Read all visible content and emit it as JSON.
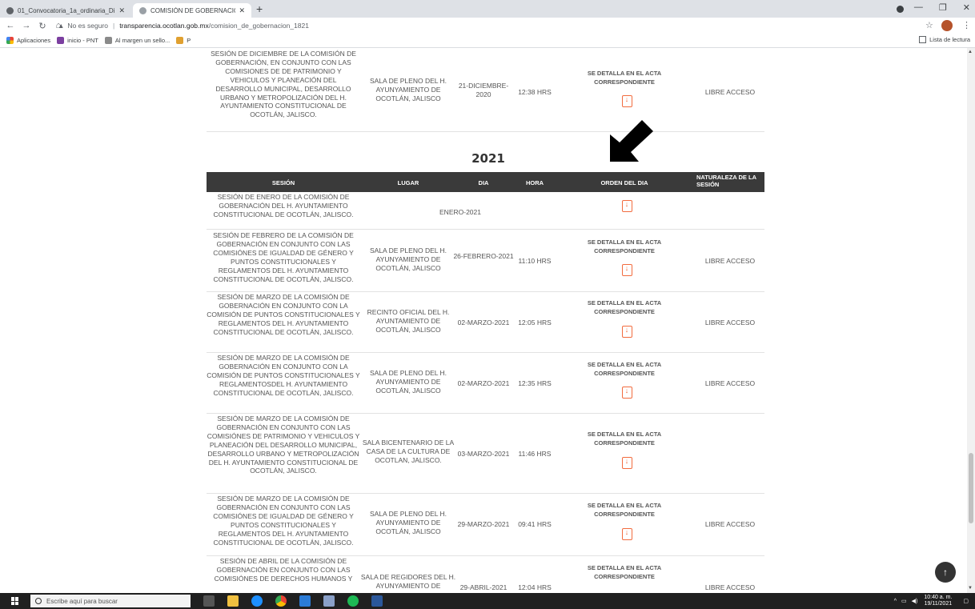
{
  "browser": {
    "tabs": [
      {
        "title": "01_Convocatoria_1a_ordinaria_Di",
        "active": false
      },
      {
        "title": "COMISIÓN DE GOBERNACIÓN |",
        "active": true
      }
    ],
    "url_warning": "No es seguro",
    "url_host": "transparencia.ocotlan.gob.mx",
    "url_path": "/comision_de_gobernacion_1821",
    "bookmarks": [
      "Aplicaciones",
      "inicio - PNT",
      "Al margen un sello...",
      "P"
    ],
    "reading_list": "Lista de lectura"
  },
  "prev_row": {
    "sesion": "SESIÓN DE DICIEMBRE DE LA COMISIÓN DE GOBERNACIÓN, EN CONJUNTO CON LAS COMISIONES DE DE PATRIMONIO Y VEHICULOS Y PLANEACIÓN DEL DESARROLLO MUNICIPAL, DESARROLLO URBANO Y METROPOLIZACIÓN DEL H. AYUNTAMIENTO CONSTITUCIONAL DE OCOTLÁN, JALISCO.",
    "lugar": "SALA DE PLENO DEL H. AYUNYAMIENTO DE OCOTLÁN, JALISCO",
    "dia": "21-DICIEMBRE-2020",
    "hora": "12:38 HRS",
    "orden": "SE DETALLA EN EL ACTA CORRESPONDIENTE",
    "naturaleza": "LIBRE ACCESO"
  },
  "year": "2021",
  "headers": {
    "sesion": "SESIÓN",
    "lugar": "LUGAR",
    "dia": "DIA",
    "hora": "HORA",
    "orden": "ORDEN DEL DIA",
    "naturaleza": "NATURALEZA DE LA SESIÓN"
  },
  "rows": [
    {
      "sesion": "SESIÓN DE ENERO DE LA COMISIÓN DE GOBERNACIÓN DEL H. AYUNTAMIENTO CONSTITUCIONAL DE OCOTLÁN, JALISCO.",
      "lugar": "",
      "dia": "ENERO-2021",
      "hora": "",
      "orden": "",
      "naturaleza": ""
    },
    {
      "sesion": "SESIÓN DE FEBRERO DE LA COMISIÓN DE GOBERNACIÓN EN CONJUNTO CON LAS COMISIÓNES DE IGUALDAD DE GÉNERO Y PUNTOS CONSTITUCIONALES Y REGLAMENTOS DEL H. AYUNTAMIENTO CONSTITUCIONAL DE OCOTLÁN, JALISCO.",
      "lugar": "SALA DE PLENO DEL H. AYUNYAMIENTO DE OCOTLÁN, JALISCO",
      "dia": "26-FEBRERO-2021",
      "hora": "11:10 HRS",
      "orden": "SE DETALLA EN EL ACTA CORRESPONDIENTE",
      "naturaleza": "LIBRE ACCESO"
    },
    {
      "sesion": "SESIÓN DE MARZO DE LA COMISIÓN DE GOBERNACIÓN EN CONJUNTO CON LA COMISIÓN DE PUNTOS CONSTITUCIONALES Y REGLAMENTOS DEL H. AYUNTAMIENTO CONSTITUCIONAL DE OCOTLÁN, JALISCO.",
      "lugar": "RECINTO OFICIAL DEL H. AYUNTAMIENTO DE OCOTLÁN, JALISCO",
      "dia": "02-MARZO-2021",
      "hora": "12:05 HRS",
      "orden": "SE DETALLA EN EL ACTA CORRESPONDIENTE",
      "naturaleza": "LIBRE ACCESO"
    },
    {
      "sesion": "SESIÓN DE MARZO DE LA COMISIÓN DE GOBERNACIÓN EN CONJUNTO CON LA COMISIÓN DE PUNTOS CONSTITUCIONALES Y REGLAMENTOSDEL H. AYUNTAMIENTO CONSTITUCIONAL DE OCOTLÁN, JALISCO.",
      "lugar": "SALA DE PLENO DEL H. AYUNYAMIENTO DE OCOTLÁN, JALISCO",
      "dia": "02-MARZO-2021",
      "hora": "12:35 HRS",
      "orden": "SE DETALLA EN EL ACTA CORRESPONDIENTE",
      "naturaleza": "LIBRE ACCESO"
    },
    {
      "sesion": "SESIÓN DE MARZO DE LA COMISIÓN DE GOBERNACIÓN EN CONJUNTO CON LAS COMISIÓNES DE PATRIMONIO Y VEHICULOS Y PLANEACIÓN DEL DESARROLLO MUNICIPAL, DESARROLLO URBANO Y METROPOLIZACIÓN DEL H. AYUNTAMIENTO CONSTITUCIONAL DE OCOTLÁN, JALISCO.",
      "lugar": "SALA BICENTENARIO DE LA CASA DE LA CULTURA DE OCOTLAN, JALISCO.",
      "dia": "03-MARZO-2021",
      "hora": "11:46 HRS",
      "orden": "SE DETALLA EN EL ACTA CORRESPONDIENTE",
      "naturaleza": ""
    },
    {
      "sesion": "SESIÓN DE MARZO DE LA COMISIÓN DE GOBERNACIÓN EN CONJUNTO CON LAS COMISIÓNES DE IGUALDAD DE GÉNERO Y PUNTOS CONSTITUCIONALES Y REGLAMENTOS DEL H. AYUNTAMIENTO CONSTITUCIONAL DE OCOTLÁN, JALISCO.",
      "lugar": "SALA DE PLENO DEL H. AYUNYAMIENTO DE OCOTLÁN, JALISCO",
      "dia": "29-MARZO-2021",
      "hora": "09:41 HRS",
      "orden": "SE DETALLA EN EL ACTA CORRESPONDIENTE",
      "naturaleza": "LIBRE ACCESO"
    },
    {
      "sesion": "SESIÓN DE ABRIL DE LA COMISIÓN DE GOBERNACIÓN EN CONJUNTO CON LAS COMISIÓNES DE DERECHOS HUMANOS Y",
      "lugar": "SALA DE REGIDORES DEL H. AYUNYAMIENTO DE",
      "dia": "29-ABRIL-2021",
      "hora": "12:04 HRS",
      "orden": "SE DETALLA EN EL ACTA CORRESPONDIENTE",
      "naturaleza": "LIBRE ACCESO"
    }
  ],
  "taskbar": {
    "search_placeholder": "Escribe aquí para buscar",
    "time": "10:40 a. m.",
    "date": "19/11/2021"
  },
  "colors": {
    "header_bg": "#3a3a3a",
    "pdf_icon": "#f26c3f",
    "tab_strip": "#dee1e6",
    "taskbar": "#202020"
  }
}
